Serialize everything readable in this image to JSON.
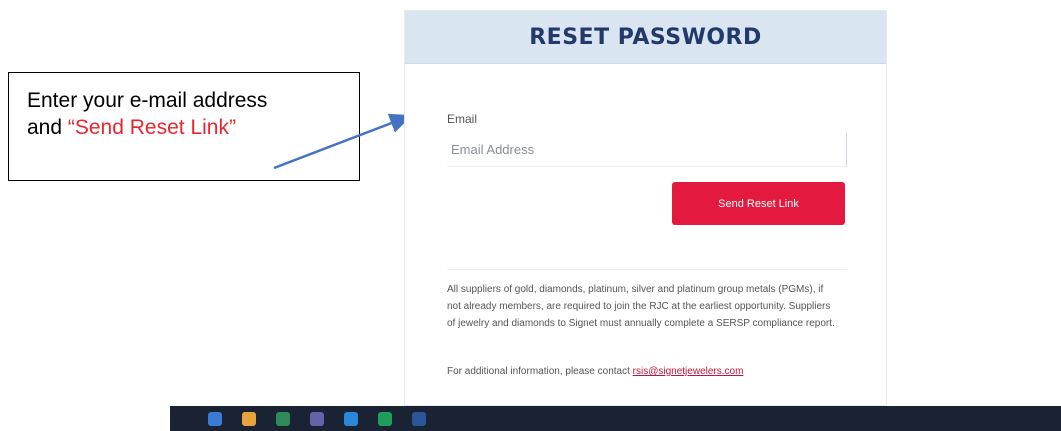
{
  "callout": {
    "line1": "Enter your e-mail address",
    "line2_prefix": "and ",
    "line2_highlight": "“Send Reset Link”"
  },
  "form": {
    "title": "RESET PASSWORD",
    "email_label": "Email",
    "email_placeholder": "Email Address",
    "email_value": "",
    "submit_label": "Send Reset Link",
    "notice": "All suppliers of gold, diamonds, platinum, silver and platinum group metals (PGMs), if not already members, are required to join the RJC at the earliest opportunity. Suppliers of jewelry and diamonds to Signet must annually complete a SERSP compliance report.",
    "contact_prefix": "For additional information, please contact ",
    "contact_email": "rsis@signetjewelers.com"
  },
  "taskbar": {
    "apps": [
      {
        "icon": "file-explorer-icon",
        "color": "#3a7bd5"
      },
      {
        "icon": "chrome-icon",
        "color": "#e8a33d"
      },
      {
        "icon": "excel-icon",
        "color": "#2e8b57"
      },
      {
        "icon": "teams-icon",
        "color": "#6264a7"
      },
      {
        "icon": "outlook-icon",
        "color": "#2b88d8"
      },
      {
        "icon": "spreadsheet-icon",
        "color": "#1e9e5a"
      },
      {
        "icon": "word-icon",
        "color": "#2b579a"
      }
    ]
  },
  "colors": {
    "accent": "#e3193f",
    "header_bg": "#d9e6f2",
    "title": "#23396b",
    "arrow": "#4472c4"
  }
}
